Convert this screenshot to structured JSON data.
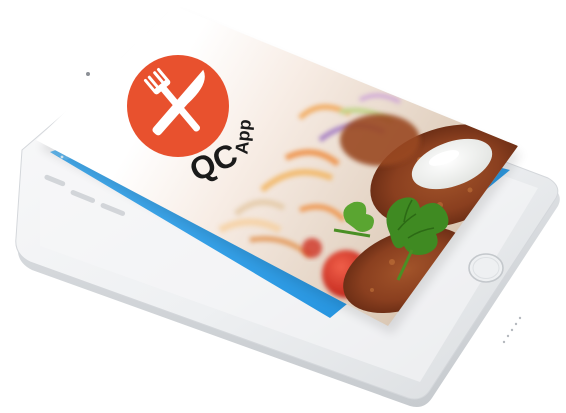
{
  "app": {
    "logo_letters": "QC",
    "logo_word": "App",
    "logo_icon": "fork-knife-crossed-icon"
  },
  "colors": {
    "brand_orange": "#e8512e",
    "brand_blue": "#1e9be8",
    "logo_dark": "#1a1a1a",
    "phone_body": "#f1f2f4",
    "blue_screen": "#3aa7ee"
  }
}
